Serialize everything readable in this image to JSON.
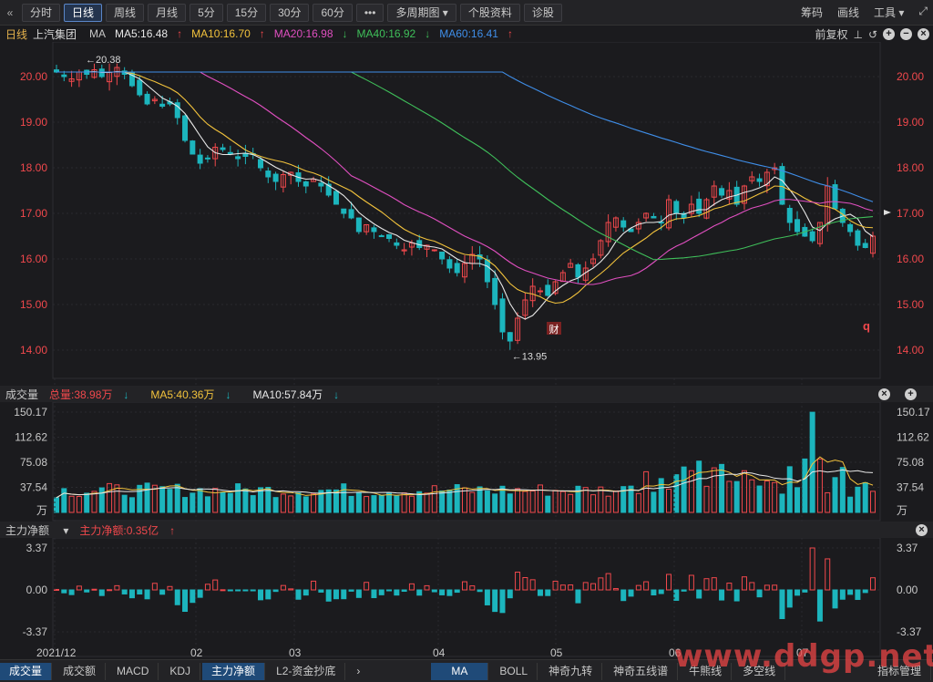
{
  "toolbar": {
    "back_icon": "double-chevron-left-icon",
    "periods": [
      "分时",
      "日线",
      "周线",
      "月线",
      "5分",
      "15分",
      "30分",
      "60分"
    ],
    "active_period": "日线",
    "more": "•••",
    "multi_period": "多周期图",
    "stock_info": "个股资料",
    "diagnose": "诊股",
    "right_items": [
      "筹码",
      "画线",
      "工具"
    ]
  },
  "ma_bar": {
    "title": "日线",
    "stock_name": "上汽集团",
    "ma_label": "MA",
    "ma": [
      {
        "label": "MA5:16.48",
        "dir": "↑",
        "color": "#e8e8e8"
      },
      {
        "label": "MA10:16.70",
        "dir": "↑",
        "color": "#f2c23c"
      },
      {
        "label": "MA20:16.98",
        "dir": "↓",
        "color": "#e04fc0"
      },
      {
        "label": "MA40:16.92",
        "dir": "↓",
        "color": "#3fbf5a"
      },
      {
        "label": "MA60:16.41",
        "dir": "↑",
        "color": "#3f8ee8"
      }
    ],
    "adjust": "前复权"
  },
  "price_axis": {
    "ticks": [
      "20.00",
      "19.00",
      "18.00",
      "17.00",
      "16.00",
      "15.00",
      "14.00"
    ],
    "high_label": "20.38",
    "low_label": "13.95",
    "marker_cai": "财",
    "marker_q": "q"
  },
  "volume": {
    "title": "成交量",
    "total": "总量:38.98万",
    "total_dir": "↓",
    "ma5": "MA5:40.36万",
    "ma5_dir": "↓",
    "ma10": "MA10:57.84万",
    "ma10_dir": "↓",
    "ticks": [
      "150.17",
      "112.62",
      "75.08",
      "37.54",
      "万"
    ]
  },
  "capital": {
    "title": "主力净额",
    "value": "主力净额:0.35亿",
    "value_dir": "↑",
    "ticks": [
      "3.37",
      "0.00",
      "-3.37"
    ]
  },
  "x_axis": {
    "labels": [
      "2021/12",
      "02",
      "03",
      "04",
      "05",
      "06",
      "07"
    ]
  },
  "bottom_tabs": [
    "成交量",
    "成交额",
    "MACD",
    "KDJ",
    "主力净额",
    "L2-资金抄底"
  ],
  "bottom_tabs_right": [
    "MA",
    "BOLL",
    "神奇九转",
    "神奇五线谱",
    "牛熊线",
    "多空线"
  ],
  "bottom_right": "指标管理",
  "watermark": "www.ddgp.net",
  "colors": {
    "up": "#f0484c",
    "down": "#1cb5bd",
    "bg": "#1b1b1e"
  },
  "chart_data": {
    "type": "candlestick",
    "series_ma": [
      "MA5",
      "MA10",
      "MA20",
      "MA40",
      "MA60"
    ],
    "close": [
      20.1,
      20.0,
      19.95,
      20.1,
      20.05,
      20.15,
      20.0,
      20.1,
      20.2,
      20.05,
      19.8,
      19.6,
      19.4,
      19.5,
      19.35,
      19.4,
      19.1,
      18.6,
      18.3,
      18.1,
      18.2,
      18.45,
      18.4,
      18.3,
      18.2,
      18.25,
      18.3,
      18.0,
      17.8,
      17.7,
      17.85,
      17.9,
      17.7,
      17.6,
      17.75,
      17.6,
      17.4,
      17.2,
      17.0,
      16.9,
      16.6,
      16.75,
      16.6,
      16.5,
      16.45,
      16.3,
      16.2,
      16.35,
      16.25,
      16.3,
      16.2,
      16.0,
      15.8,
      15.7,
      15.9,
      16.1,
      16.0,
      15.5,
      15.0,
      14.4,
      14.2,
      14.7,
      15.1,
      15.4,
      15.3,
      15.2,
      15.5,
      15.7,
      15.9,
      15.6,
      15.8,
      16.0,
      16.4,
      16.8,
      16.9,
      16.7,
      16.6,
      16.8,
      17.0,
      16.9,
      16.8,
      17.3,
      17.0,
      16.9,
      17.2,
      17.0,
      17.3,
      17.6,
      17.4,
      17.5,
      17.2,
      17.6,
      17.8,
      17.7,
      17.9,
      18.0,
      17.2,
      16.8,
      16.6,
      16.5,
      16.4,
      16.8,
      17.6,
      17.1,
      16.8,
      16.6,
      16.3,
      16.25,
      16.5
    ]
  }
}
